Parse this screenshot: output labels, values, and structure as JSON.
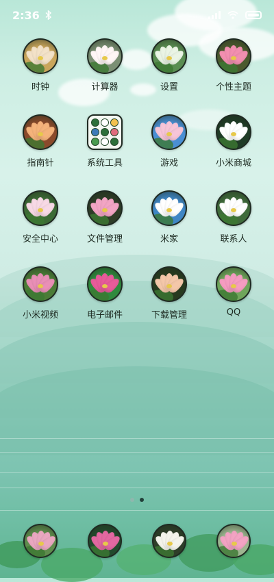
{
  "status_bar": {
    "time": "2:36",
    "battery_level": 1.0
  },
  "apps": [
    {
      "label": "时钟",
      "icon": "lotus-gold-icon",
      "bg": "#c9a55b",
      "flower": "#f3e2c8"
    },
    {
      "label": "计算器",
      "icon": "lotus-white-icon",
      "bg": "#7b8f74",
      "flower": "#fff6f6"
    },
    {
      "label": "设置",
      "icon": "lotus-field-icon",
      "bg": "#5a8d52",
      "flower": "#eaf4e4"
    },
    {
      "label": "个性主题",
      "icon": "lotus-pink-icon",
      "bg": "#4c5a2e",
      "flower": "#f28fb0"
    },
    {
      "label": "指南针",
      "icon": "lotus-painted-icon",
      "bg": "#8b4a2b",
      "flower": "#f5b37b"
    },
    {
      "label": "系统工具",
      "icon": "tools-folder-icon",
      "bg": "#f3f6ef",
      "flower": "#2d6f3a"
    },
    {
      "label": "游戏",
      "icon": "lotus-sky-icon",
      "bg": "#4a8fd4",
      "flower": "#f7c5d8"
    },
    {
      "label": "小米商城",
      "icon": "lotus-dark-icon",
      "bg": "#1f3b26",
      "flower": "#ffffff"
    },
    {
      "label": "安全中心",
      "icon": "lotus-soft-icon",
      "bg": "#3c6a35",
      "flower": "#f7d9e5"
    },
    {
      "label": "文件管理",
      "icon": "lotus-bloom-icon",
      "bg": "#2e3c27",
      "flower": "#f2a5c4"
    },
    {
      "label": "米家",
      "icon": "lotus-lake-icon",
      "bg": "#3f86c5",
      "flower": "#ffffff"
    },
    {
      "label": "联系人",
      "icon": "lotus-leaf-icon",
      "bg": "#3f6b3b",
      "flower": "#ffffff"
    },
    {
      "label": "小米视频",
      "icon": "lotus-pond-icon",
      "bg": "#4b7c37",
      "flower": "#e98fb6"
    },
    {
      "label": "电子邮件",
      "icon": "lotus-green-icon",
      "bg": "#2f8a3d",
      "flower": "#e75b9a"
    },
    {
      "label": "下载管理",
      "icon": "lotus-bud-icon",
      "bg": "#273a1f",
      "flower": "#f4c7a9"
    },
    {
      "label": "QQ",
      "icon": "lotus-rose-icon",
      "bg": "#6fa55b",
      "flower": "#f59cc1"
    }
  ],
  "dock": [
    {
      "icon": "dock-lotus-pond-icon",
      "bg": "#5f8c4d",
      "flower": "#e9a7c0"
    },
    {
      "icon": "dock-lotus-pink-icon",
      "bg": "#224a2d",
      "flower": "#e268a1"
    },
    {
      "icon": "dock-lotus-white-icon",
      "bg": "#2e3e29",
      "flower": "#f4f4ec"
    },
    {
      "icon": "dock-lotus-field-icon",
      "bg": "#9db690",
      "flower": "#f3a3c3"
    }
  ],
  "pages": {
    "count": 2,
    "active": 1
  }
}
